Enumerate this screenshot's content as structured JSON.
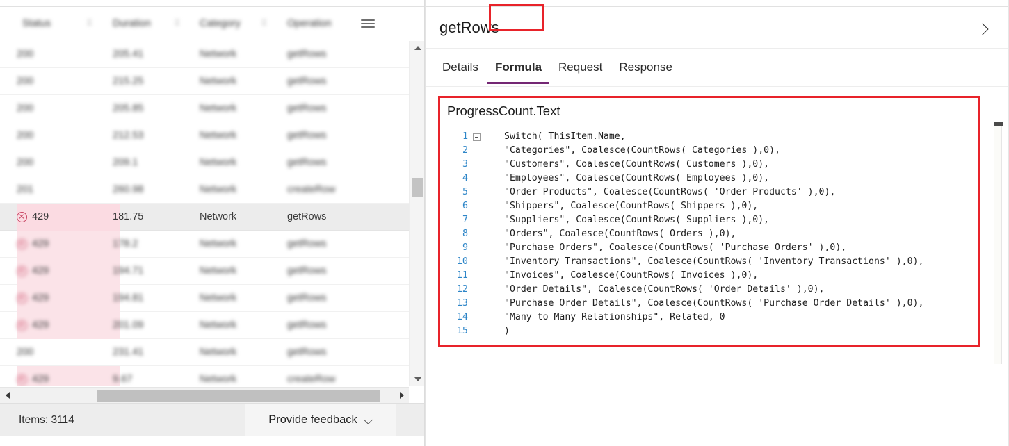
{
  "monitor_table": {
    "columns": [
      "Status",
      "Duration",
      "Category",
      "Operation"
    ],
    "menu_icon": "hamburger-icon",
    "rows": [
      {
        "status": "200",
        "duration": "205.41",
        "category": "Network",
        "operation": "getRows",
        "error": false,
        "blurred": true
      },
      {
        "status": "200",
        "duration": "215.25",
        "category": "Network",
        "operation": "getRows",
        "error": false,
        "blurred": true
      },
      {
        "status": "200",
        "duration": "205.85",
        "category": "Network",
        "operation": "getRows",
        "error": false,
        "blurred": true
      },
      {
        "status": "200",
        "duration": "212.53",
        "category": "Network",
        "operation": "getRows",
        "error": false,
        "blurred": true
      },
      {
        "status": "200",
        "duration": "209.1",
        "category": "Network",
        "operation": "getRows",
        "error": false,
        "blurred": true
      },
      {
        "status": "201",
        "duration": "260.98",
        "category": "Network",
        "operation": "createRow",
        "error": false,
        "blurred": true
      },
      {
        "status": "429",
        "duration": "181.75",
        "category": "Network",
        "operation": "getRows",
        "error": true,
        "blurred": false,
        "selected": true
      },
      {
        "status": "429",
        "duration": "178.2",
        "category": "Network",
        "operation": "getRows",
        "error": true,
        "blurred": true
      },
      {
        "status": "429",
        "duration": "194.71",
        "category": "Network",
        "operation": "getRows",
        "error": true,
        "blurred": true
      },
      {
        "status": "429",
        "duration": "194.81",
        "category": "Network",
        "operation": "getRows",
        "error": true,
        "blurred": true
      },
      {
        "status": "429",
        "duration": "201.09",
        "category": "Network",
        "operation": "getRows",
        "error": true,
        "blurred": true
      },
      {
        "status": "200",
        "duration": "231.41",
        "category": "Network",
        "operation": "getRows",
        "error": false,
        "blurred": true
      },
      {
        "status": "429",
        "duration": "9.67",
        "category": "Network",
        "operation": "createRow",
        "error": true,
        "blurred": true
      }
    ]
  },
  "status_bar": {
    "items_label": "Items: 3114",
    "feedback_label": "Provide feedback",
    "feedback_chevron": "chevron-down-icon"
  },
  "details_pane": {
    "title": "getRows",
    "collapse_icon": "chevron-right-icon",
    "tabs": [
      {
        "label": "Details",
        "active": false
      },
      {
        "label": "Formula",
        "active": true,
        "highlighted": true
      },
      {
        "label": "Request",
        "active": false
      },
      {
        "label": "Response",
        "active": false
      }
    ],
    "formula": {
      "property_name": "ProgressCount.Text",
      "lines": [
        {
          "n": "1",
          "text": "Switch( ThisItem.Name,",
          "fold": true,
          "indent": 0
        },
        {
          "n": "2",
          "text": "        \"Categories\", Coalesce(CountRows( Categories ),0),",
          "fold": false,
          "indent": 1
        },
        {
          "n": "3",
          "text": "        \"Customers\", Coalesce(CountRows( Customers ),0),",
          "fold": false,
          "indent": 1
        },
        {
          "n": "4",
          "text": "        \"Employees\", Coalesce(CountRows( Employees ),0),",
          "fold": false,
          "indent": 1
        },
        {
          "n": "5",
          "text": "        \"Order Products\", Coalesce(CountRows( 'Order Products' ),0),",
          "fold": false,
          "indent": 1
        },
        {
          "n": "6",
          "text": "        \"Shippers\", Coalesce(CountRows( Shippers ),0),",
          "fold": false,
          "indent": 1
        },
        {
          "n": "7",
          "text": "        \"Suppliers\", Coalesce(CountRows( Suppliers ),0),",
          "fold": false,
          "indent": 1
        },
        {
          "n": "8",
          "text": "        \"Orders\", Coalesce(CountRows( Orders ),0),",
          "fold": false,
          "indent": 1
        },
        {
          "n": "9",
          "text": "        \"Purchase Orders\", Coalesce(CountRows( 'Purchase Orders' ),0),",
          "fold": false,
          "indent": 1
        },
        {
          "n": "10",
          "text": "        \"Inventory Transactions\", Coalesce(CountRows( 'Inventory Transactions' ),0),",
          "fold": false,
          "indent": 1
        },
        {
          "n": "11",
          "text": "        \"Invoices\", Coalesce(CountRows( Invoices ),0),",
          "fold": false,
          "indent": 1
        },
        {
          "n": "12",
          "text": "        \"Order Details\", Coalesce(CountRows( 'Order Details' ),0),",
          "fold": false,
          "indent": 1
        },
        {
          "n": "13",
          "text": "        \"Purchase Order Details\", Coalesce(CountRows( 'Purchase Order Details' ),0),",
          "fold": false,
          "indent": 1
        },
        {
          "n": "14",
          "text": "        \"Many to Many Relationships\", Related, 0",
          "fold": false,
          "indent": 1
        },
        {
          "n": "15",
          "text": ")",
          "fold": false,
          "indent": 0
        }
      ]
    }
  },
  "colors": {
    "annotation_red": "#e8232a",
    "active_tab_underline": "#742774",
    "error_pink_bg": "#fbe3e8",
    "error_icon": "#c7415f",
    "line_number_blue": "#2e86c8",
    "selected_row_bg": "#ececec"
  }
}
